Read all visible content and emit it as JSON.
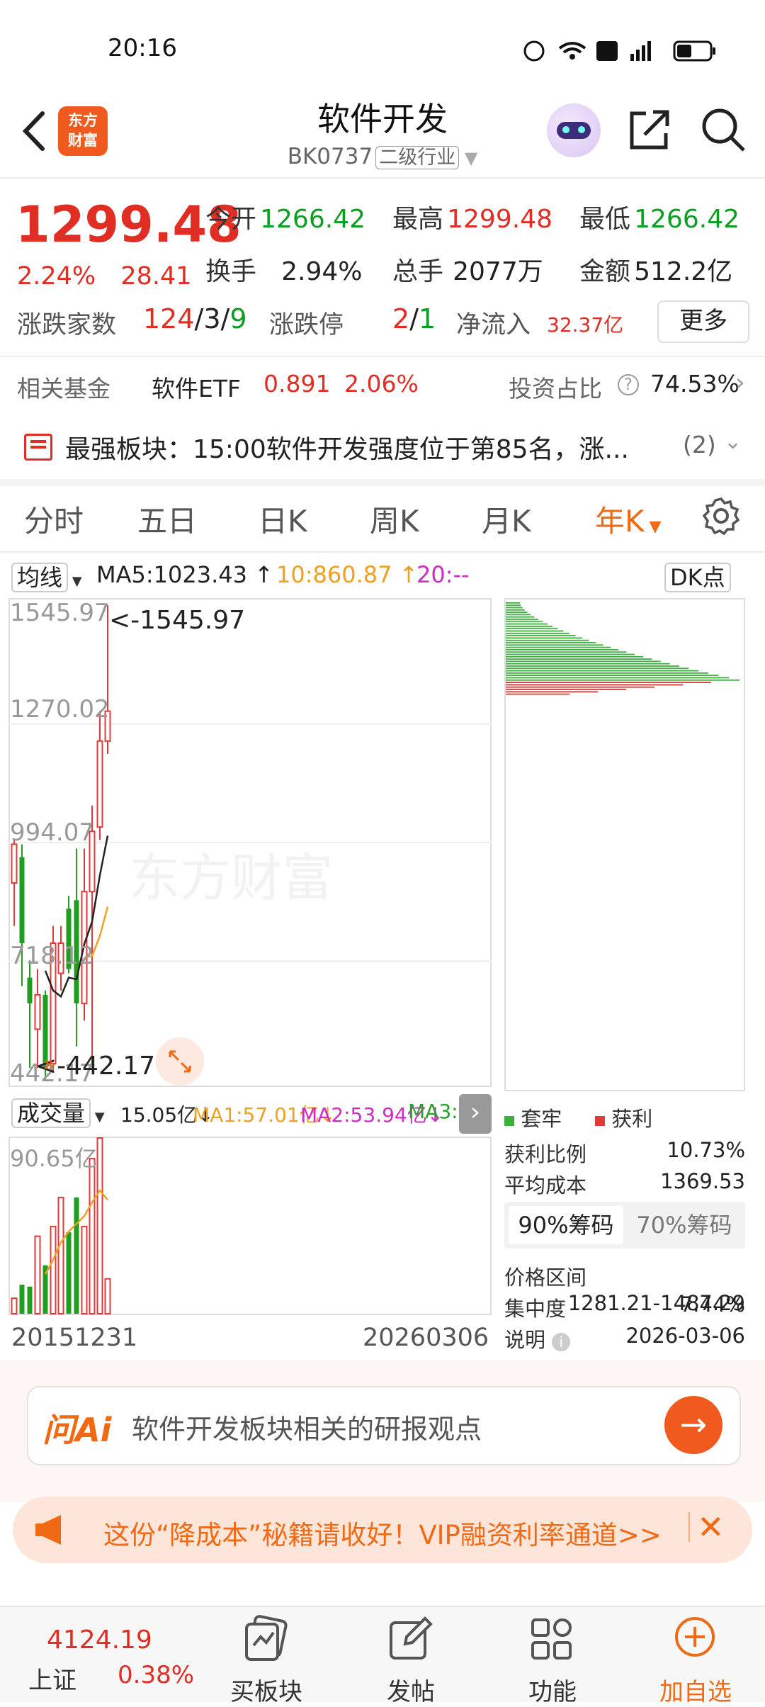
{
  "status_bar": {
    "time": "20:16"
  },
  "header": {
    "logo_text_line1": "东方",
    "logo_text_line2": "财富",
    "title": "软件开发",
    "code": "BK0737",
    "industry_tag": "二级行业"
  },
  "quote": {
    "price": "1299.48",
    "change_pct": "2.24%",
    "change_abs": "28.41",
    "open_label": "今开",
    "open": "1266.42",
    "high_label": "最高",
    "high": "1299.48",
    "low_label": "最低",
    "low": "1266.42",
    "turnover_label": "换手",
    "turnover": "2.94%",
    "volume_label": "总手",
    "volume": "2077万",
    "amount_label": "金额",
    "amount": "512.2亿",
    "updown_label": "涨跌家数",
    "up": "124",
    "flat": "3",
    "down": "9",
    "limit_label": "涨跌停",
    "limit_up": "2",
    "limit_down": "1",
    "inflow_label": "净流入",
    "inflow": "32.37亿",
    "more_label": "更多",
    "sep": "/"
  },
  "fund": {
    "label": "相关基金",
    "name": "软件ETF",
    "price": "0.891",
    "pct": "2.06%",
    "ratio_label": "投资占比",
    "ratio": "74.53%"
  },
  "news": {
    "text": "最强板块：15:00软件开发强度位于第85名，涨...",
    "count": "(2)"
  },
  "tabs": [
    "分时",
    "五日",
    "日K",
    "周K",
    "月K",
    "年K"
  ],
  "ma_bar": {
    "select": "均线",
    "ma5": "MA5:1023.43",
    "ma10": "10:860.87",
    "ma20": "20:--",
    "dk_label": "DK点"
  },
  "kchart_labels": {
    "y_top": "1545.97",
    "y_mid1": "1270.02",
    "y_mid2": "994.07",
    "y_mid3": "718.12",
    "y_bottom": "442.17",
    "max_marker": "<-1545.97",
    "min_marker": "<-442.17",
    "watermark": "东方财富"
  },
  "vol_bar": {
    "select": "成交量",
    "vol": "15.05亿",
    "ma1": "MA1:57.01亿",
    "ma2": "MA2:53.94亿",
    "ma3": "MA3:--",
    "y_top": "90.65亿"
  },
  "dates": {
    "start": "20151231",
    "end": "20260306"
  },
  "chips": {
    "legend_trapped": "套牢",
    "legend_profit": "获利",
    "profit_ratio_label": "获利比例",
    "profit_ratio": "10.73%",
    "avg_cost_label": "平均成本",
    "avg_cost": "1369.53",
    "tab90": "90%筹码",
    "tab70": "70%筹码",
    "range_label": "价格区间",
    "range": "1281.21-1487.29",
    "concentration_label": "集中度",
    "concentration": "7.44%",
    "note_label": "说明",
    "note_date": "2026-03-06",
    "colors": {
      "trapped": "#3cb03c",
      "profit": "#e03a3a"
    }
  },
  "chart_data": {
    "type": "candlestick",
    "title": "",
    "ylim": [
      442.17,
      1545.97
    ],
    "candles": [
      {
        "open": 900,
        "close": 990,
        "high": 1000,
        "low": 800,
        "color": "red"
      },
      {
        "open": 960,
        "close": 760,
        "high": 990,
        "low": 660,
        "color": "green"
      },
      {
        "open": 680,
        "close": 620,
        "high": 720,
        "low": 470,
        "color": "green"
      },
      {
        "open": 560,
        "close": 640,
        "high": 700,
        "low": 470,
        "color": "red"
      },
      {
        "open": 640,
        "close": 470,
        "high": 650,
        "low": 442.17,
        "color": "green"
      },
      {
        "open": 480,
        "close": 760,
        "high": 800,
        "low": 460,
        "color": "red"
      },
      {
        "open": 760,
        "close": 690,
        "high": 800,
        "low": 650,
        "color": "red"
      },
      {
        "open": 700,
        "close": 840,
        "high": 870,
        "low": 690,
        "color": "green"
      },
      {
        "open": 860,
        "close": 620,
        "high": 980,
        "low": 520,
        "color": "green"
      },
      {
        "open": 620,
        "close": 880,
        "high": 980,
        "low": 580,
        "color": "red"
      },
      {
        "open": 880,
        "close": 1020,
        "high": 1080,
        "low": 480,
        "color": "red"
      },
      {
        "open": 1030,
        "close": 1230,
        "high": 1300,
        "low": 1000,
        "color": "red"
      },
      {
        "open": 1230,
        "close": 1299.48,
        "high": 1545.97,
        "low": 1200,
        "color": "red"
      }
    ],
    "volumes": [
      8,
      15,
      14,
      40,
      25,
      45,
      60,
      42,
      60,
      45,
      80,
      90.65,
      18
    ]
  },
  "ai": {
    "logo": "问Ai",
    "placeholder": "软件开发板块相关的研报观点",
    "arrow": "→"
  },
  "promo": {
    "text": "这份“降成本”秘籍请收好！VIP融资利率通道>>",
    "close": "✕"
  },
  "bottom_nav": {
    "index_value": "4124.19",
    "index_name": "上证",
    "index_pct": "0.38%",
    "items": [
      "买板块",
      "发帖",
      "功能",
      "加自选"
    ]
  }
}
